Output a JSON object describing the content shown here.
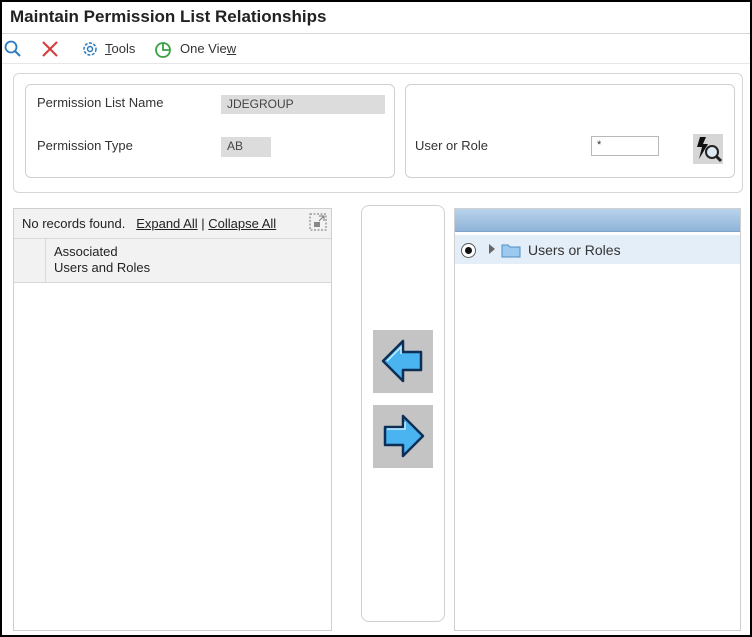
{
  "window": {
    "title": "Maintain Permission List Relationships"
  },
  "toolbar": {
    "search_icon": "search-icon",
    "close_icon": "close-icon",
    "tools_label_first": "T",
    "tools_label_rest": "ools",
    "oneview_label_first": "One Vie",
    "oneview_label_rest": "w"
  },
  "header": {
    "permission_list_name_label": "Permission List Name",
    "permission_list_name_value": "JDEGROUP",
    "permission_type_label": "Permission Type",
    "permission_type_value": "AB",
    "user_or_role_label": "User or Role",
    "user_or_role_value": "*"
  },
  "left_grid": {
    "message": "No records found.",
    "expand_all": "Expand All",
    "separator": "|",
    "collapse_all": "Collapse All",
    "column_line1": "Associated",
    "column_line2": "Users and Roles"
  },
  "right_tree": {
    "node_label": "Users or Roles",
    "selected": true
  },
  "colors": {
    "header_bar": "#9fc1e2",
    "selected_row": "#e4eef8",
    "arrow_fill": "#49b4f0"
  }
}
